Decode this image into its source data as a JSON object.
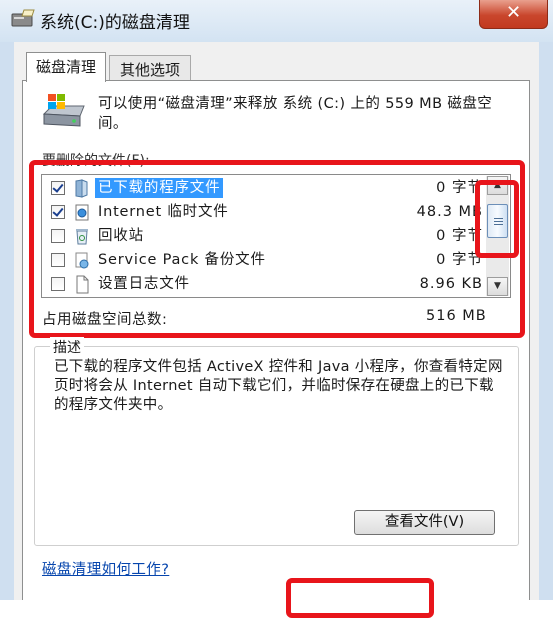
{
  "window": {
    "title": "系统(C:)的磁盘清理",
    "close_label": "✕"
  },
  "tabs": [
    {
      "label": "磁盘清理",
      "active": true
    },
    {
      "label": "其他选项",
      "active": false
    }
  ],
  "intro": {
    "text": "可以使用“磁盘清理”来释放 系统 (C:) 上的 559 MB 磁盘空间。"
  },
  "files_label": "要删除的文件(F):",
  "files": [
    {
      "label": "已下载的程序文件",
      "size": "0 字节",
      "checked": true,
      "selected": true,
      "icon": "folder-icon"
    },
    {
      "label": "Internet 临时文件",
      "size": "48.3 MB",
      "checked": true,
      "selected": false,
      "icon": "internet-icon"
    },
    {
      "label": "回收站",
      "size": "0 字节",
      "checked": false,
      "selected": false,
      "icon": "recycle-bin-icon"
    },
    {
      "label": "Service Pack 备份文件",
      "size": "0 字节",
      "checked": false,
      "selected": false,
      "icon": "service-pack-icon"
    },
    {
      "label": "设置日志文件",
      "size": "8.96 KB",
      "checked": false,
      "selected": false,
      "icon": "document-icon"
    }
  ],
  "total": {
    "label": "占用磁盘空间总数:",
    "value": "516 MB"
  },
  "description": {
    "title": "描述",
    "text": "已下载的程序文件包括 ActiveX 控件和 Java 小程序，你查看特定网页时将会从 Internet 自动下载它们，并临时保存在硬盘上的已下载的程序文件夹中。",
    "view_button": "查看文件(V)"
  },
  "help_link": "磁盘清理如何工作?",
  "colors": {
    "highlight": "#e8151b",
    "selection": "#3399ff",
    "link": "#0645ad"
  }
}
